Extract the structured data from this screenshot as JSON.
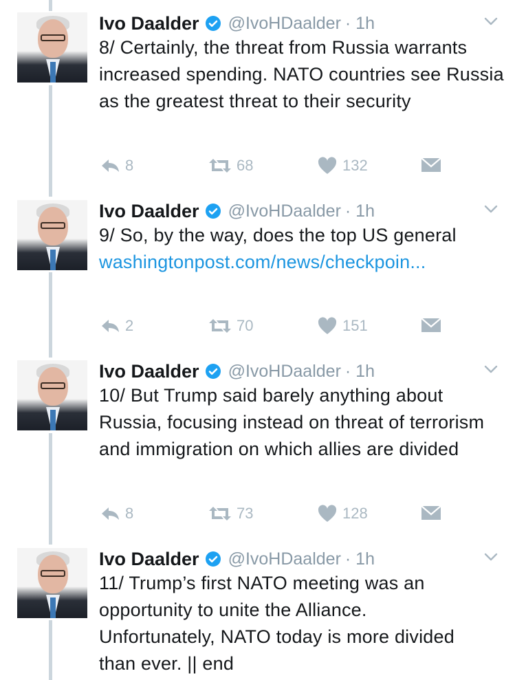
{
  "tweets": [
    {
      "name": "Ivo Daalder",
      "handle": "@IvoHDaalder",
      "time": "· 1h",
      "text": "8/ Certainly, the threat from Russia warrants increased spending. NATO countries see Russia as the greatest threat to their security",
      "link": "",
      "replies": "8",
      "retweets": "68",
      "likes": "132"
    },
    {
      "name": "Ivo Daalder",
      "handle": "@IvoHDaalder",
      "time": "· 1h",
      "text": "9/ So, by the way, does the top US general ",
      "link": "washingtonpost.com/news/checkpoin...",
      "replies": "2",
      "retweets": "70",
      "likes": "151"
    },
    {
      "name": "Ivo Daalder",
      "handle": "@IvoHDaalder",
      "time": "· 1h",
      "text": "10/ But Trump said barely anything about Russia, focusing instead on threat of terrorism and immigration on which allies are divided",
      "link": "",
      "replies": "8",
      "retweets": "73",
      "likes": "128"
    },
    {
      "name": "Ivo Daalder",
      "handle": "@IvoHDaalder",
      "time": "· 1h",
      "text": "11/ Trump’s first NATO meeting was an opportunity to unite the Alliance. Unfortunately, NATO today is more divided than ever. || end",
      "link": "",
      "replies": "",
      "retweets": "",
      "likes": ""
    }
  ],
  "colors": {
    "text": "#14171a",
    "muted": "#8899a6",
    "action": "#aab8c2",
    "link": "#1b95e0",
    "verified": "#1da1f2",
    "thread_line": "#ccd6dd"
  },
  "icons": [
    "verified-badge-icon",
    "chevron-down-icon",
    "reply-icon",
    "retweet-icon",
    "like-icon",
    "direct-message-icon"
  ]
}
